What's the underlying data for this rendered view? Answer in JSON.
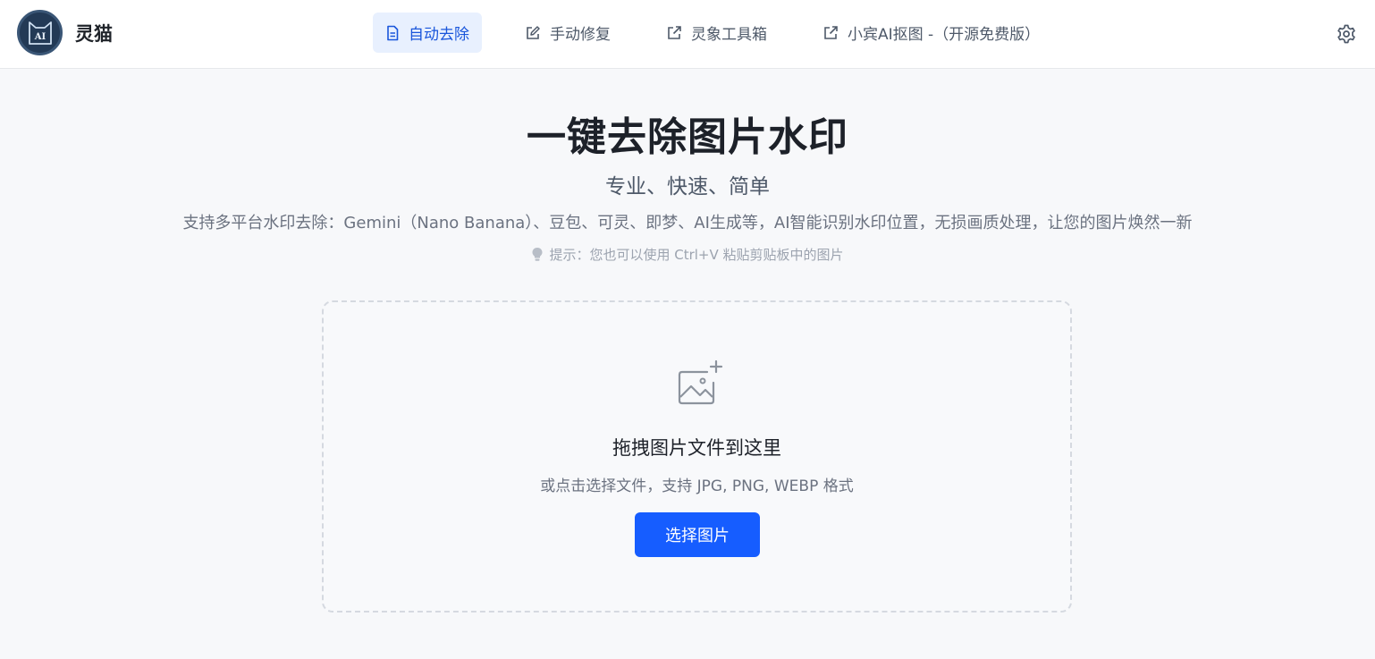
{
  "app": {
    "title": "灵猫",
    "logo_text": "AI"
  },
  "nav": {
    "items": [
      {
        "label": "自动去除",
        "icon": "document-icon",
        "active": true
      },
      {
        "label": "手动修复",
        "icon": "edit-icon",
        "active": false
      },
      {
        "label": "灵象工具箱",
        "icon": "external-link-icon",
        "active": false
      },
      {
        "label": "小宾AI抠图 -（开源免费版）",
        "icon": "external-link-icon",
        "active": false
      }
    ]
  },
  "hero": {
    "title": "一键去除图片水印",
    "subtitle": "专业、快速、简单",
    "description": "支持多平台水印去除：Gemini（Nano Banana）、豆包、可灵、即梦、AI生成等，AI智能识别水印位置，无损画质处理，让您的图片焕然一新",
    "tip": "提示：您也可以使用 Ctrl+V 粘贴剪贴板中的图片"
  },
  "upload": {
    "title": "拖拽图片文件到这里",
    "subtitle": "或点击选择文件，支持 JPG, PNG, WEBP 格式",
    "button_label": "选择图片"
  },
  "colors": {
    "accent": "#165dff",
    "active_nav_bg": "#e8f0fe",
    "active_nav_text": "#1a56db",
    "background": "#f7f8fa"
  }
}
